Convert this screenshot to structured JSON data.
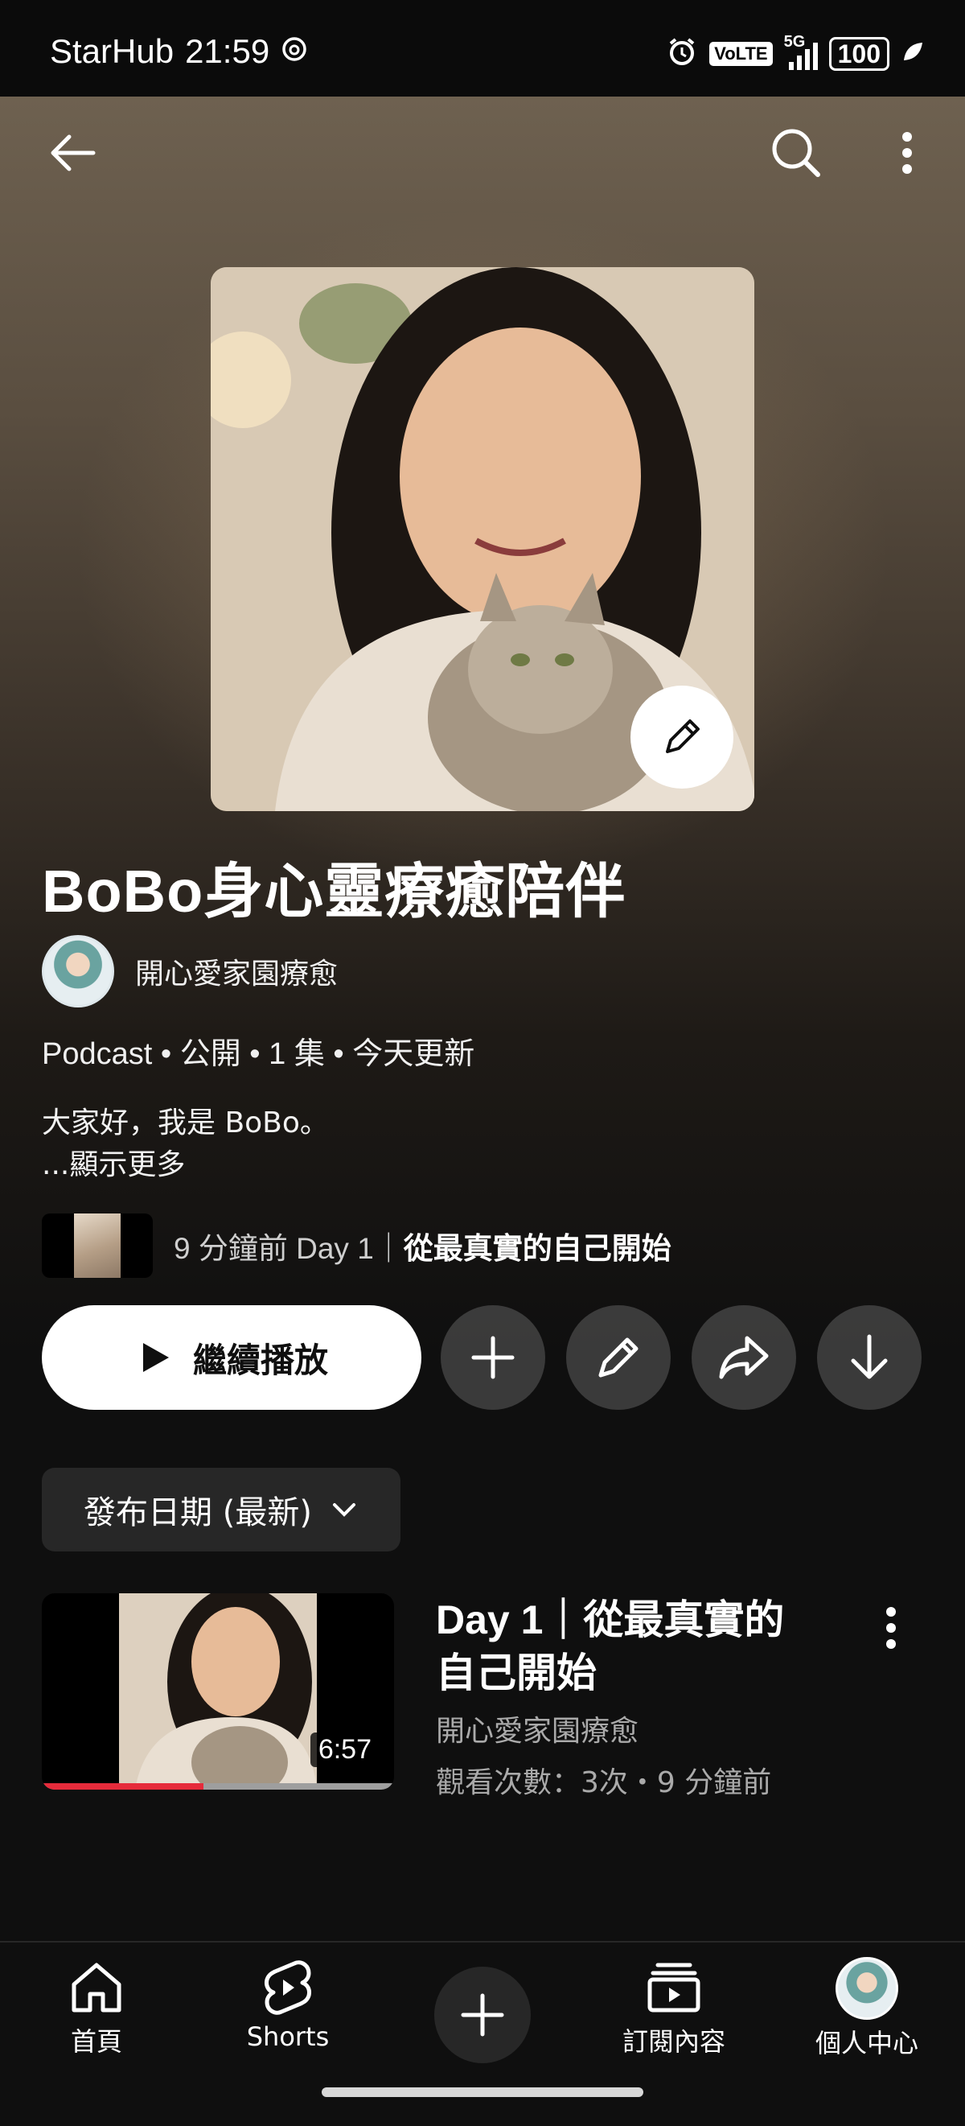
{
  "status": {
    "carrier": "StarHub",
    "time": "21:59",
    "volte": "VoLTE",
    "network": "5G",
    "battery": "100"
  },
  "playlist": {
    "title": "BoBo身心靈療癒陪伴",
    "channel": "開心愛家園療愈",
    "meta": "Podcast • 公開 • 1 集 • 今天更新",
    "description": "大家好，我是 BoBo。",
    "show_more": "...顯示更多",
    "recent_prefix": "9 分鐘前 Day 1｜",
    "recent_title": "從最真實的自己開始"
  },
  "actions": {
    "play_label": "繼續播放"
  },
  "sort": {
    "label": "發布日期 (最新)"
  },
  "episodes": [
    {
      "title": "Day 1｜從最真實的自己開始",
      "channel": "開心愛家園療愈",
      "stats": "觀看次數：3次・9 分鐘前",
      "duration": "6:57",
      "watched_fraction": 0.46
    }
  ],
  "nav": {
    "home": "首頁",
    "shorts": "Shorts",
    "subscriptions": "訂閱內容",
    "you": "個人中心"
  }
}
